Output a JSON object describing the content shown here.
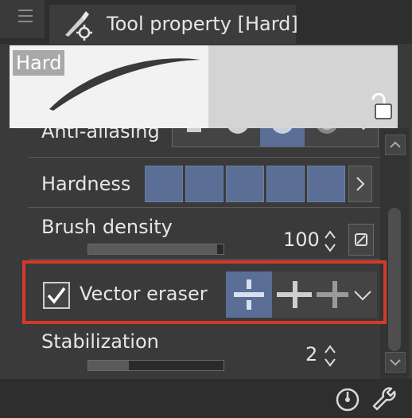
{
  "tab": {
    "title": "Tool property [Hard]"
  },
  "preview": {
    "label": "Hard"
  },
  "properties": {
    "anti_aliasing": {
      "label": "Anti-aliasing"
    },
    "hardness": {
      "label": "Hardness"
    },
    "brush_density": {
      "label": "Brush density",
      "value": "100",
      "fraction": 0.95
    },
    "vector_eraser": {
      "label": "Vector eraser",
      "checked": true
    },
    "stabilization": {
      "label": "Stabilization",
      "value": "2",
      "fraction": 0.3
    }
  },
  "colors": {
    "accent": "#5a6e96",
    "highlight": "#d23a2b"
  },
  "icons": [
    "menu-icon",
    "brush-settings-icon",
    "lock-icon",
    "chevron-down-icon",
    "chevron-right-icon",
    "reset-icon",
    "spinner-icon",
    "gauge-icon",
    "wrench-icon"
  ]
}
